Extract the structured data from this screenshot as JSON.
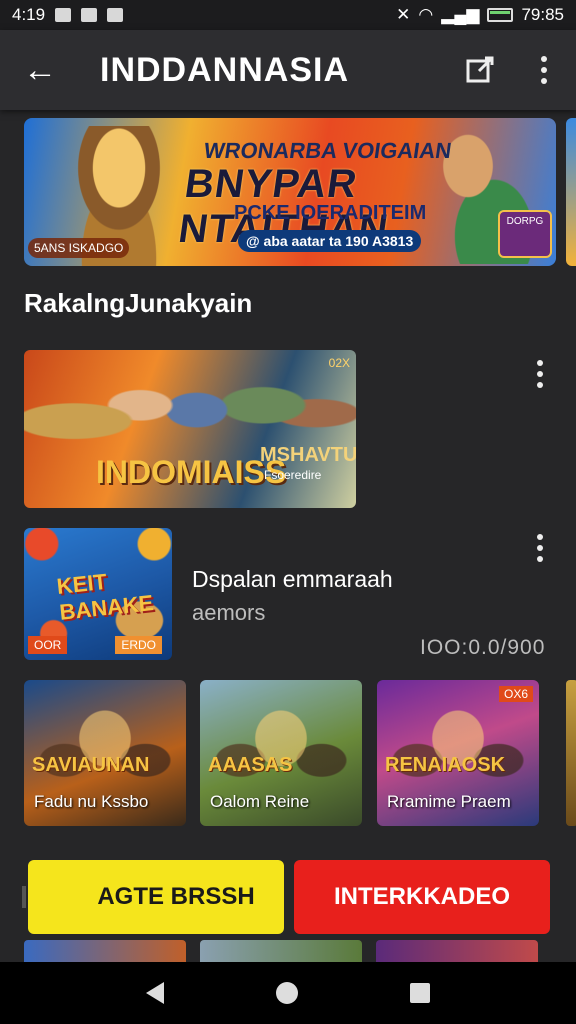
{
  "status_bar": {
    "time": "4:19",
    "clock_right": "79:85"
  },
  "app_bar": {
    "title": "INDDANNASIA"
  },
  "banner": {
    "line1": "WRONARBA VOIGAIAN",
    "line2": "BNYPAR NTAITHAN",
    "line3": "PCKE IOERADITEIM",
    "tag": "@ aba aatar ta 190 A3813",
    "badge_left": "5ANS ISKADGO",
    "box_label": "DORPG"
  },
  "section": {
    "title": "RakalngJunakyain"
  },
  "featured": {
    "title": "INDOMIAISS",
    "subtitle": "MSHAVTUS",
    "subtitle2": "Fsoeredire",
    "corner": "02X"
  },
  "list_item": {
    "thumb_title": "KEIT BANAKE",
    "thumb_tag": "OOR",
    "thumb_tag2": "ERDO",
    "title": "Dspalan emmaraah",
    "subtitle": "aemors",
    "count": "IOO:0.0/900"
  },
  "grid": [
    {
      "logo": "SAVIAUNAN",
      "label": "Fadu nu Kssbo",
      "corner": ""
    },
    {
      "logo": "AAASAS",
      "label": "Oalom Reine",
      "corner": ""
    },
    {
      "logo": "RENAIAOSK",
      "label": "Rramime Praem",
      "corner": "OX6"
    }
  ],
  "buttons": {
    "primary": "AGTE BRSSH",
    "secondary": "INTERKKADEO"
  },
  "colors": {
    "yellow_button": "#f5e51c",
    "red_button": "#e8201c",
    "app_bar": "#2d2d30",
    "background": "#262628"
  }
}
